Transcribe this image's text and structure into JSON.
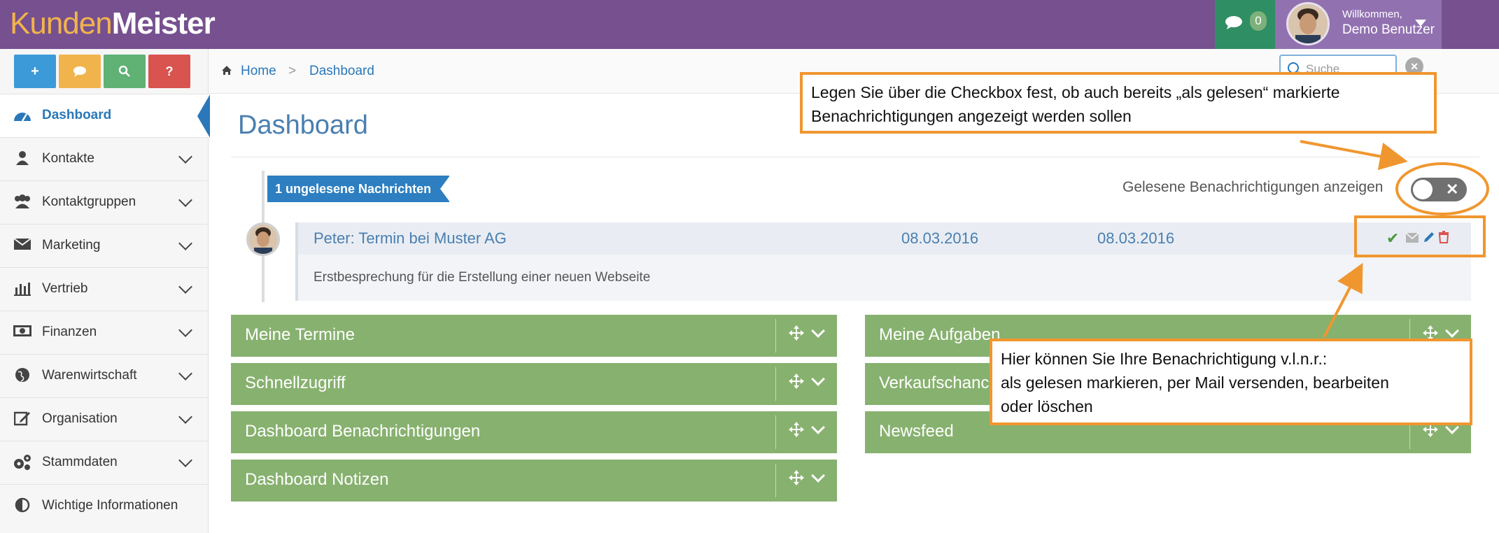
{
  "app": {
    "logo_part1": "Kunden",
    "logo_part2": "Meister",
    "messages_count": "0",
    "welcome_label": "Willkommen,",
    "user_name": "Demo Benutzer"
  },
  "quick_buttons": [
    {
      "label": "+",
      "color": "#3d9ad9",
      "icon": "plus-icon"
    },
    {
      "label": "",
      "color": "#f1b44c",
      "icon": "chat-icon"
    },
    {
      "label": "",
      "color": "#5fb174",
      "icon": "search-icon"
    },
    {
      "label": "?",
      "color": "#d9534f",
      "icon": "help-icon"
    }
  ],
  "sidebar": {
    "items": [
      {
        "label": "Dashboard",
        "icon": "dashboard-icon",
        "active": true
      },
      {
        "label": "Kontakte",
        "icon": "user-icon"
      },
      {
        "label": "Kontaktgruppen",
        "icon": "users-icon"
      },
      {
        "label": "Marketing",
        "icon": "envelope-icon"
      },
      {
        "label": "Vertrieb",
        "icon": "bar-chart-icon"
      },
      {
        "label": "Finanzen",
        "icon": "money-icon"
      },
      {
        "label": "Warenwirtschaft",
        "icon": "globe-icon"
      },
      {
        "label": "Organisation",
        "icon": "edit-icon"
      },
      {
        "label": "Stammdaten",
        "icon": "gears-icon"
      },
      {
        "label": "Wichtige Informationen",
        "icon": "half-circle-icon"
      }
    ]
  },
  "breadcrumb": {
    "home": "Home",
    "separator": ">",
    "current": "Dashboard"
  },
  "search": {
    "placeholder": "Suche"
  },
  "page": {
    "title": "Dashboard"
  },
  "notifications": {
    "unread_label": "1 ungelesene Nachrichten",
    "toggle_label": "Gelesene Benachrichtigungen anzeigen",
    "items": [
      {
        "title": "Peter: Termin bei Muster AG",
        "date_start": "08.03.2016",
        "date_end": "08.03.2016",
        "body": "Erstbesprechung für die Erstellung einer neuen Webseite"
      }
    ]
  },
  "widgets": {
    "left": [
      "Meine Termine",
      "Schnellzugriff",
      "Dashboard Benachrichtigungen",
      "Dashboard Notizen"
    ],
    "right": [
      "Meine Aufgaben",
      "Verkaufschancen",
      "Newsfeed"
    ]
  },
  "annotations": {
    "top": [
      "Legen Sie über die Checkbox fest, ob auch bereits „als gelesen“ markierte",
      "Benachrichtigungen angezeigt werden sollen"
    ],
    "bottom": [
      "Hier können Sie Ihre Benachrichtigung v.l.n.r.:",
      "als gelesen markieren, per Mail versenden,  bearbeiten",
      "oder löschen"
    ]
  },
  "colors": {
    "topbar": "#76508f",
    "accent_blue": "#2a78b9",
    "widget_green": "#87b16f",
    "annotation_orange": "#f0962f"
  }
}
